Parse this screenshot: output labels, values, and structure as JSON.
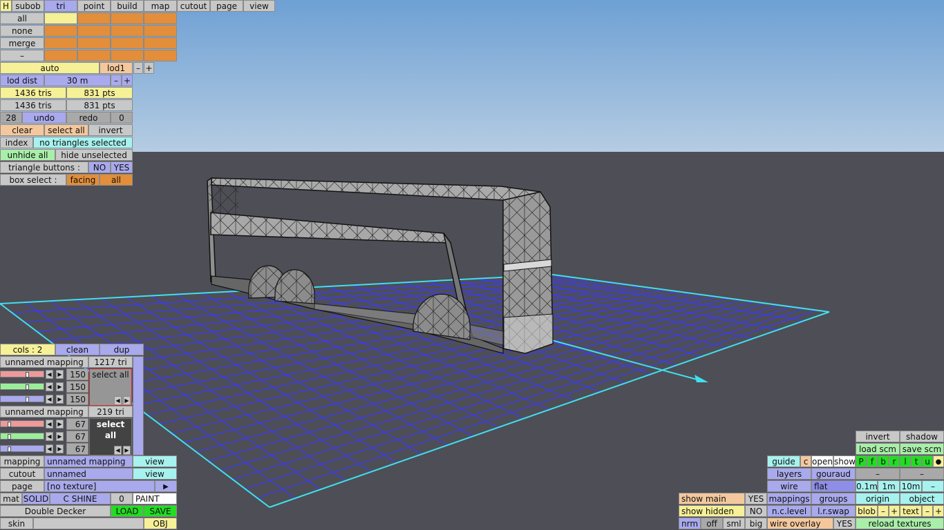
{
  "colors": {
    "sky_top": "#6ea0d4",
    "sky_bottom": "#b5cce2",
    "floor": "#4e4e56",
    "grid_line": "#3a3aff",
    "grid_border": "#40e0f0"
  },
  "top_menu": {
    "h": "H",
    "subob": "subob",
    "tri": "tri",
    "point": "point",
    "build": "build",
    "map": "map",
    "cutout": "cutout",
    "page": "page",
    "view": "view"
  },
  "select_col": [
    "all",
    "none",
    "merge",
    "–"
  ],
  "lod": {
    "auto": "auto",
    "lod1": "lod1",
    "minus": "–",
    "plus": "+",
    "dist_label": "lod dist",
    "dist_value": "30 m"
  },
  "stats": {
    "tris1": "1436 tris",
    "pts1": "831 pts",
    "tris2": "1436 tris",
    "pts2": "831 pts"
  },
  "history": {
    "count": "28",
    "undo": "undo",
    "redo": "redo",
    "redo_count": "0"
  },
  "sel": {
    "clear": "clear",
    "select_all": "select all",
    "invert": "invert"
  },
  "index": {
    "label": "index",
    "status": "no triangles selected"
  },
  "hide": {
    "unhide_all": "unhide all",
    "hide_unselected": "hide unselected"
  },
  "tri_buttons": {
    "label": "triangle buttons :",
    "no": "NO",
    "yes": "YES"
  },
  "box_select": {
    "label": "box select :",
    "facing": "facing",
    "all": "all"
  },
  "cols": {
    "label": "cols : 2",
    "clean": "clean",
    "dup": "dup"
  },
  "mapping1": {
    "name": "unnamed mapping",
    "count": "1217 tri",
    "r": "150",
    "g": "150",
    "b": "150",
    "select_all": "select all"
  },
  "mapping2": {
    "name": "unnamed mapping",
    "count": "219 tri",
    "r": "67",
    "g": "67",
    "b": "67",
    "select_all": "select all"
  },
  "arrows": {
    "left": "◀",
    "right": "▶"
  },
  "bottom_left": {
    "mapping_label": "mapping",
    "mapping_value": "unnamed mapping",
    "mapping_view": "view",
    "cutout_label": "cutout",
    "cutout_value": "unnamed",
    "cutout_view": "view",
    "page_label": "page",
    "page_value": "[no texture]",
    "page_arrow": "▶",
    "mat": "mat",
    "solid": "SOLID",
    "c_shine": "C SHINE",
    "zero": "0",
    "paint": "PAINT",
    "model_name": "Double Decker",
    "load": "LOAD",
    "save": "SAVE",
    "skin": "skin",
    "obj": "OBJ"
  },
  "bottom_right": {
    "invert": "invert",
    "shadow": "shadow",
    "load_scm": "load scm",
    "save_scm": "save scm",
    "guide": "guide",
    "c": "c",
    "open": "open",
    "show": "show",
    "flags": [
      "P",
      "f",
      "b",
      "r",
      "l",
      "t",
      "u"
    ],
    "dot": "●",
    "layers": "layers",
    "gouraud": "gouraud",
    "dash1": "–",
    "dash2": "–",
    "wire": "wire",
    "flat": "flat",
    "s01": "0.1m",
    "s1": "1m",
    "s10": "10m",
    "sminus": "–",
    "show_main": "show main",
    "show_main_val": "YES",
    "mappings": "mappings",
    "groups": "groups",
    "origin": "origin",
    "object": "object",
    "show_hidden": "show hidden",
    "show_hidden_val": "NO",
    "nc_level": "n.c.level",
    "lr_swap": "l.r.swap",
    "blob": "blob",
    "blob_minus": "–",
    "blob_plus": "+",
    "text": "text",
    "text_minus": "–",
    "text_plus": "+",
    "nrm": "nrm",
    "off": "off",
    "sml": "sml",
    "big": "big",
    "wire_overlay": "wire overlay",
    "wire_overlay_val": "YES",
    "reload": "reload textures"
  }
}
